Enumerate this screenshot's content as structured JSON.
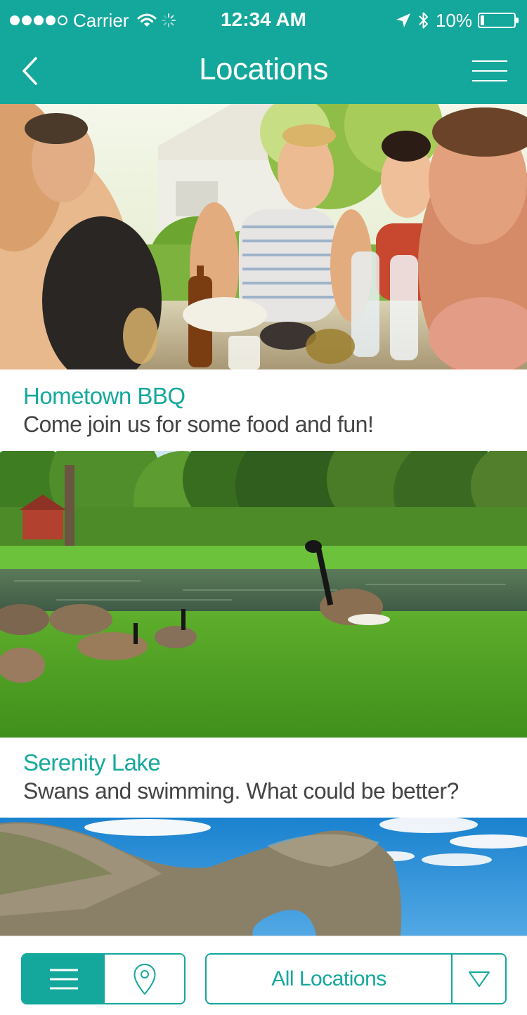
{
  "status_bar": {
    "carrier": "Carrier",
    "time": "12:34 AM",
    "battery_percent": "10%",
    "battery_level": 0.1,
    "signal_bars_filled": 4,
    "signal_bars_total": 5
  },
  "nav": {
    "title": "Locations",
    "back_icon": "chevron-left-icon",
    "menu_icon": "hamburger-menu-icon"
  },
  "locations": [
    {
      "title": "Hometown BBQ",
      "description": "Come join us for some food and fun!",
      "image": "people-at-outdoor-table-photo"
    },
    {
      "title": "Serenity Lake",
      "description": "Swans and swimming. What could be better?",
      "image": "geese-by-lake-photo"
    },
    {
      "title": "",
      "description": "",
      "image": "rock-arch-coastline-photo"
    }
  ],
  "bottom_bar": {
    "list_view_icon": "list-icon",
    "map_view_icon": "map-pin-icon",
    "filter_label": "All Locations",
    "filter_icon": "triangle-down-icon"
  },
  "colors": {
    "accent": "#14a79b",
    "title_text": "#16a89c",
    "body_text": "#444444"
  }
}
